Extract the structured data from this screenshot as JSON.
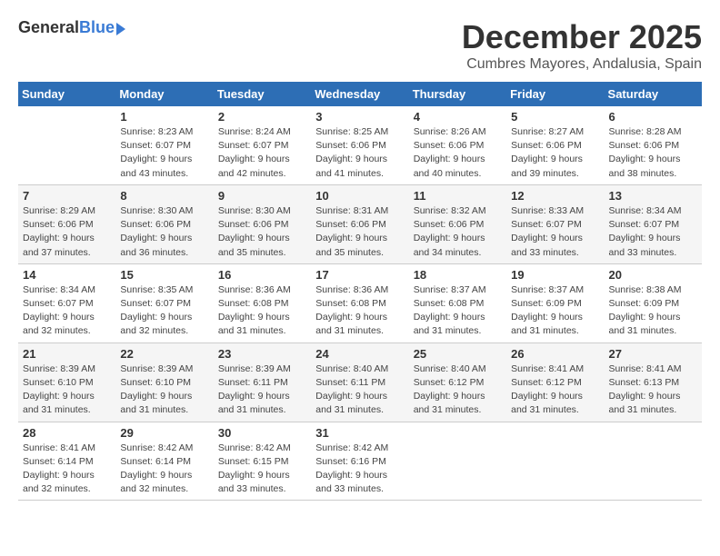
{
  "header": {
    "logo_general": "General",
    "logo_blue": "Blue",
    "month": "December 2025",
    "location": "Cumbres Mayores, Andalusia, Spain"
  },
  "weekdays": [
    "Sunday",
    "Monday",
    "Tuesday",
    "Wednesday",
    "Thursday",
    "Friday",
    "Saturday"
  ],
  "weeks": [
    [
      {
        "day": "",
        "info": ""
      },
      {
        "day": "1",
        "info": "Sunrise: 8:23 AM\nSunset: 6:07 PM\nDaylight: 9 hours\nand 43 minutes."
      },
      {
        "day": "2",
        "info": "Sunrise: 8:24 AM\nSunset: 6:07 PM\nDaylight: 9 hours\nand 42 minutes."
      },
      {
        "day": "3",
        "info": "Sunrise: 8:25 AM\nSunset: 6:06 PM\nDaylight: 9 hours\nand 41 minutes."
      },
      {
        "day": "4",
        "info": "Sunrise: 8:26 AM\nSunset: 6:06 PM\nDaylight: 9 hours\nand 40 minutes."
      },
      {
        "day": "5",
        "info": "Sunrise: 8:27 AM\nSunset: 6:06 PM\nDaylight: 9 hours\nand 39 minutes."
      },
      {
        "day": "6",
        "info": "Sunrise: 8:28 AM\nSunset: 6:06 PM\nDaylight: 9 hours\nand 38 minutes."
      }
    ],
    [
      {
        "day": "7",
        "info": "Sunrise: 8:29 AM\nSunset: 6:06 PM\nDaylight: 9 hours\nand 37 minutes."
      },
      {
        "day": "8",
        "info": "Sunrise: 8:30 AM\nSunset: 6:06 PM\nDaylight: 9 hours\nand 36 minutes."
      },
      {
        "day": "9",
        "info": "Sunrise: 8:30 AM\nSunset: 6:06 PM\nDaylight: 9 hours\nand 35 minutes."
      },
      {
        "day": "10",
        "info": "Sunrise: 8:31 AM\nSunset: 6:06 PM\nDaylight: 9 hours\nand 35 minutes."
      },
      {
        "day": "11",
        "info": "Sunrise: 8:32 AM\nSunset: 6:06 PM\nDaylight: 9 hours\nand 34 minutes."
      },
      {
        "day": "12",
        "info": "Sunrise: 8:33 AM\nSunset: 6:07 PM\nDaylight: 9 hours\nand 33 minutes."
      },
      {
        "day": "13",
        "info": "Sunrise: 8:34 AM\nSunset: 6:07 PM\nDaylight: 9 hours\nand 33 minutes."
      }
    ],
    [
      {
        "day": "14",
        "info": "Sunrise: 8:34 AM\nSunset: 6:07 PM\nDaylight: 9 hours\nand 32 minutes."
      },
      {
        "day": "15",
        "info": "Sunrise: 8:35 AM\nSunset: 6:07 PM\nDaylight: 9 hours\nand 32 minutes."
      },
      {
        "day": "16",
        "info": "Sunrise: 8:36 AM\nSunset: 6:08 PM\nDaylight: 9 hours\nand 31 minutes."
      },
      {
        "day": "17",
        "info": "Sunrise: 8:36 AM\nSunset: 6:08 PM\nDaylight: 9 hours\nand 31 minutes."
      },
      {
        "day": "18",
        "info": "Sunrise: 8:37 AM\nSunset: 6:08 PM\nDaylight: 9 hours\nand 31 minutes."
      },
      {
        "day": "19",
        "info": "Sunrise: 8:37 AM\nSunset: 6:09 PM\nDaylight: 9 hours\nand 31 minutes."
      },
      {
        "day": "20",
        "info": "Sunrise: 8:38 AM\nSunset: 6:09 PM\nDaylight: 9 hours\nand 31 minutes."
      }
    ],
    [
      {
        "day": "21",
        "info": "Sunrise: 8:39 AM\nSunset: 6:10 PM\nDaylight: 9 hours\nand 31 minutes."
      },
      {
        "day": "22",
        "info": "Sunrise: 8:39 AM\nSunset: 6:10 PM\nDaylight: 9 hours\nand 31 minutes."
      },
      {
        "day": "23",
        "info": "Sunrise: 8:39 AM\nSunset: 6:11 PM\nDaylight: 9 hours\nand 31 minutes."
      },
      {
        "day": "24",
        "info": "Sunrise: 8:40 AM\nSunset: 6:11 PM\nDaylight: 9 hours\nand 31 minutes."
      },
      {
        "day": "25",
        "info": "Sunrise: 8:40 AM\nSunset: 6:12 PM\nDaylight: 9 hours\nand 31 minutes."
      },
      {
        "day": "26",
        "info": "Sunrise: 8:41 AM\nSunset: 6:12 PM\nDaylight: 9 hours\nand 31 minutes."
      },
      {
        "day": "27",
        "info": "Sunrise: 8:41 AM\nSunset: 6:13 PM\nDaylight: 9 hours\nand 31 minutes."
      }
    ],
    [
      {
        "day": "28",
        "info": "Sunrise: 8:41 AM\nSunset: 6:14 PM\nDaylight: 9 hours\nand 32 minutes."
      },
      {
        "day": "29",
        "info": "Sunrise: 8:42 AM\nSunset: 6:14 PM\nDaylight: 9 hours\nand 32 minutes."
      },
      {
        "day": "30",
        "info": "Sunrise: 8:42 AM\nSunset: 6:15 PM\nDaylight: 9 hours\nand 33 minutes."
      },
      {
        "day": "31",
        "info": "Sunrise: 8:42 AM\nSunset: 6:16 PM\nDaylight: 9 hours\nand 33 minutes."
      },
      {
        "day": "",
        "info": ""
      },
      {
        "day": "",
        "info": ""
      },
      {
        "day": "",
        "info": ""
      }
    ]
  ]
}
